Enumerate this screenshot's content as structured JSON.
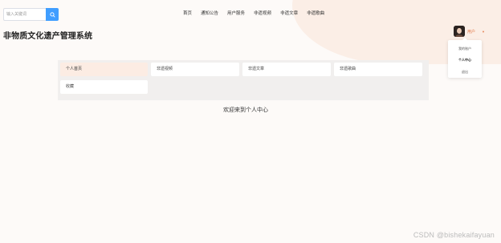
{
  "search": {
    "placeholder": "输入关键词"
  },
  "nav": [
    "首页",
    "通知公告",
    "用户服务",
    "非遗视频",
    "非遗文章",
    "非遗歌曲"
  ],
  "site_title": "非物质文化遗产管理系统",
  "user": {
    "name": "用户"
  },
  "dropdown": [
    "我的账户",
    "个人中心",
    "退出"
  ],
  "tabs": [
    "个人首页",
    "非遗视频",
    "非遗文章",
    "非遗歌曲",
    "收藏"
  ],
  "welcome": "欢迎来到个人中心",
  "watermark": "CSDN @bishekaifayuan",
  "colors": {
    "accent": "#409eff",
    "highlight": "#fcece3",
    "username": "#e37b4b"
  }
}
